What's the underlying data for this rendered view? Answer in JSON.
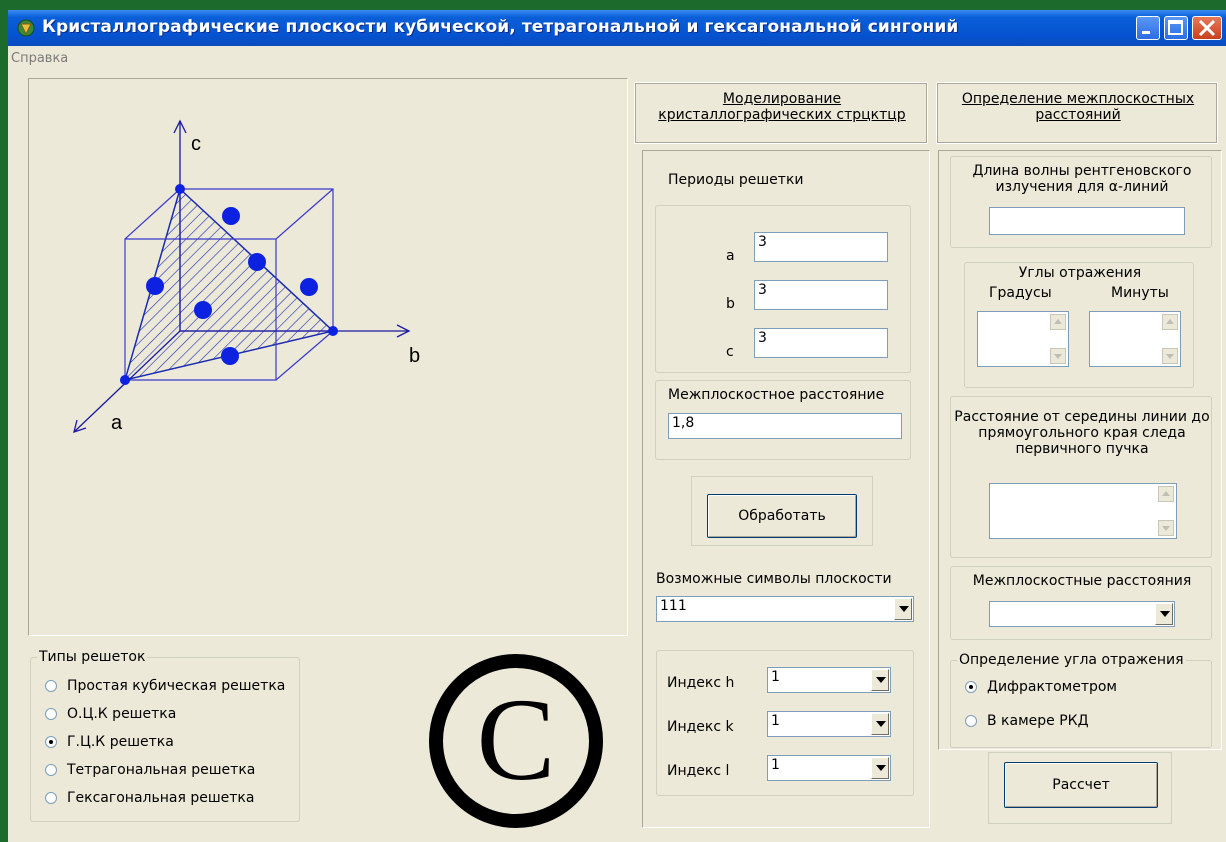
{
  "window": {
    "title": "Кристаллографические плоскости кубической, тетрагональной и гексагональной сингоний"
  },
  "menu": {
    "help": "Справка"
  },
  "diagram": {
    "axis_a": "a",
    "axis_b": "b",
    "axis_c": "c"
  },
  "lattice_types": {
    "title": "Типы решеток",
    "options": [
      {
        "label": "Простая кубическая решетка",
        "selected": false
      },
      {
        "label": "О.Ц.К решетка",
        "selected": false
      },
      {
        "label": "Г.Ц.К решетка",
        "selected": true
      },
      {
        "label": "Тетрагональная решетка",
        "selected": false
      },
      {
        "label": "Гексагональная решетка",
        "selected": false
      }
    ]
  },
  "copyright_symbol": "©",
  "modeling": {
    "header": "Моделирование кристаллографических стрцктцр",
    "periods_title": "Периоды решетки",
    "a_label": "a",
    "a_value": "3",
    "b_label": "b",
    "b_value": "3",
    "c_label": "c",
    "c_value": "3",
    "spacing_label": "Межплоскостное расстояние",
    "spacing_value": "1,8",
    "process_button": "Обработать",
    "symbols_label": "Возможные  символы плоскости",
    "symbols_value": "111",
    "index_h_label": "Индекс h",
    "index_h_value": "1",
    "index_k_label": "Индекс k",
    "index_k_value": "1",
    "index_l_label": "Индекс l",
    "index_l_value": "1"
  },
  "spacing": {
    "header": "Определение межплоскостных расстояний",
    "wavelength_label": "Длина волны рентгеновского излучения для  α-линий",
    "wavelength_value": "",
    "angles_title": "Углы отражения",
    "degrees_label": "Градусы",
    "minutes_label": "Минуты",
    "distance_label": "Расстояние от середины линии до прямоугольного края следа первичного пучка",
    "spacings_label": "Межплоскостные расстояния",
    "spacings_value": "",
    "angle_method_title": "Определение угла отражения",
    "method_options": [
      {
        "label": "Дифрактометром",
        "selected": true
      },
      {
        "label": "В камере РКД",
        "selected": false
      }
    ],
    "calc_button": "Рассчет"
  }
}
